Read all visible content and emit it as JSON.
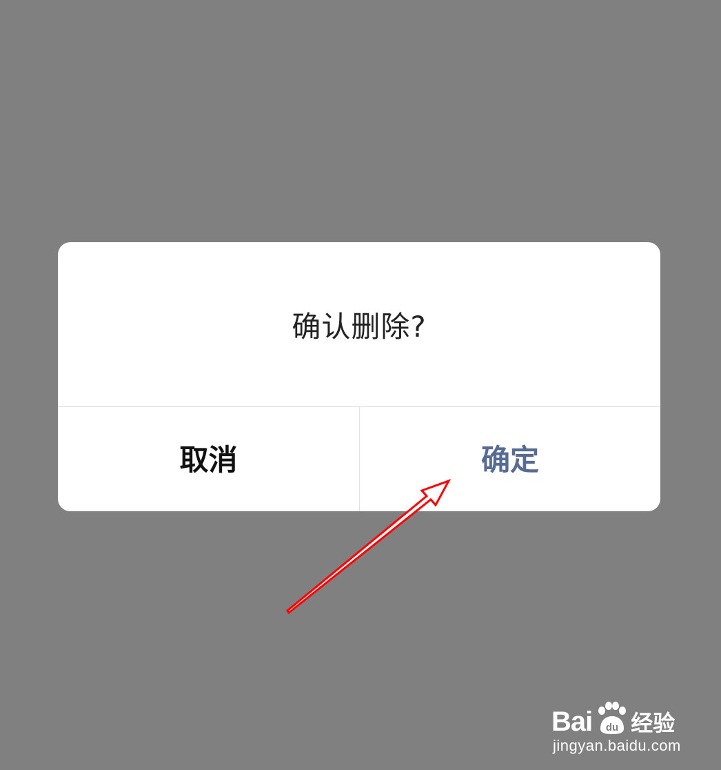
{
  "dialog": {
    "message": "确认删除?",
    "cancel_label": "取消",
    "confirm_label": "确定"
  },
  "watermark": {
    "brand": "Bai",
    "brand_suffix": "经验",
    "url": "jingyan.baidu.com"
  },
  "colors": {
    "overlay": "#808080",
    "confirm_text": "#576b95",
    "cancel_text": "#111111",
    "arrow": "#ff0000"
  },
  "icons": {
    "annotation": "red-arrow-icon",
    "paw": "baidu-paw-icon"
  }
}
